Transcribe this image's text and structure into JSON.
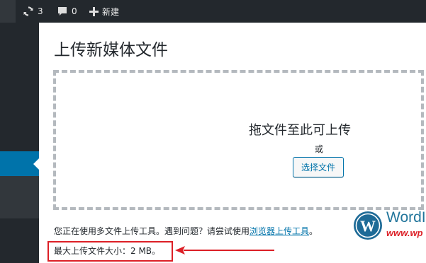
{
  "adminbar": {
    "updates_count": "3",
    "comments_count": "0",
    "new_label": "新建"
  },
  "upload": {
    "title": "上传新媒体文件",
    "drop_text": "拖文件至此可上传",
    "or_text": "或",
    "select_button": "选择文件",
    "help_prefix": "您正在使用多文件上传工具。遇到问题？请尝试使用",
    "help_link": "浏览器上传工具",
    "help_suffix": "。",
    "max_size": "最大上传文件大小：2 MB。"
  },
  "watermark": {
    "text": "WordI",
    "url": "www.wp"
  },
  "colors": {
    "adminbar_bg": "#23282d",
    "menu_active": "#0073aa",
    "link": "#0073aa",
    "annotation_red": "#dc1f26"
  }
}
